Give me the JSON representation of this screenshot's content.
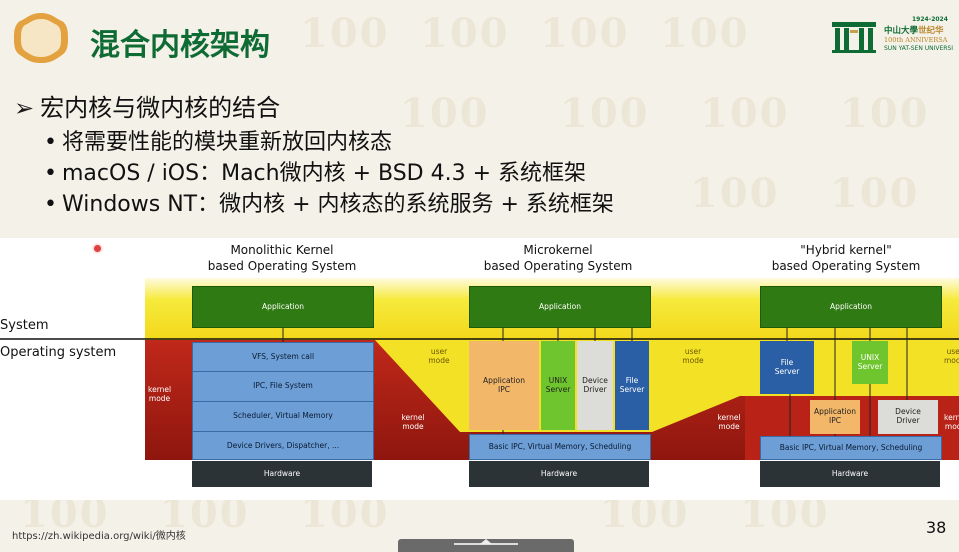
{
  "slide": {
    "title": "混合内核架构",
    "heading": "宏内核与微内核的结合",
    "bullets": [
      "将需要性能的模块重新放回内核态",
      "macOS / iOS：Mach微内核 + BSD 4.3 + 系统框架",
      "Windows NT：微内核 + 内核态的系统服务 + 系统框架"
    ],
    "source_url": "https://zh.wikipedia.org/wiki/微内核",
    "page_number": "38"
  },
  "logo": {
    "years": "1924-2024",
    "cn_name": "中山大學",
    "anniv_cn": "世纪华",
    "anniv_en": "100th ANNIVERSA",
    "en_name": "SUN YAT-SEN UNIVERSI"
  },
  "diagram": {
    "side_labels": {
      "system": "System",
      "operating_system": "Operating system"
    },
    "mode_labels": {
      "user": "user\nmode",
      "kernel": "kernel\nmode"
    },
    "monolithic": {
      "header": "Monolithic Kernel\nbased Operating System",
      "application": "Application",
      "layers": [
        "VFS, System call",
        "IPC, File System",
        "Scheduler, Virtual Memory",
        "Device Drivers, Dispatcher, ..."
      ],
      "hardware": "Hardware"
    },
    "micro": {
      "header": "Microkernel\nbased Operating System",
      "application": "Application",
      "servers": [
        "Application\nIPC",
        "UNIX\nServer",
        "Device\nDriver",
        "File\nServer"
      ],
      "core": "Basic IPC, Virtual Memory, Scheduling",
      "hardware": "Hardware"
    },
    "hybrid": {
      "header": "\"Hybrid kernel\"\nbased Operating System",
      "application": "Application",
      "user_servers": [
        "File\nServer",
        "UNIX\nServer"
      ],
      "kernel_servers": [
        "Application\nIPC",
        "Device\nDriver"
      ],
      "core": "Basic IPC, Virtual Memory, Scheduling",
      "hardware": "Hardware"
    },
    "colors": {
      "application_green": "#2f7a12",
      "yellow_band": "#f2e21a",
      "kernel_red": "#a11c12",
      "layer_blue": "#6d9fd6",
      "hardware_dark": "#2b3337",
      "ipc_orange": "#f3b76a",
      "unix_green": "#6fc52d",
      "driver_gray": "#dcdcd8",
      "file_blue": "#2a5fa5"
    }
  }
}
